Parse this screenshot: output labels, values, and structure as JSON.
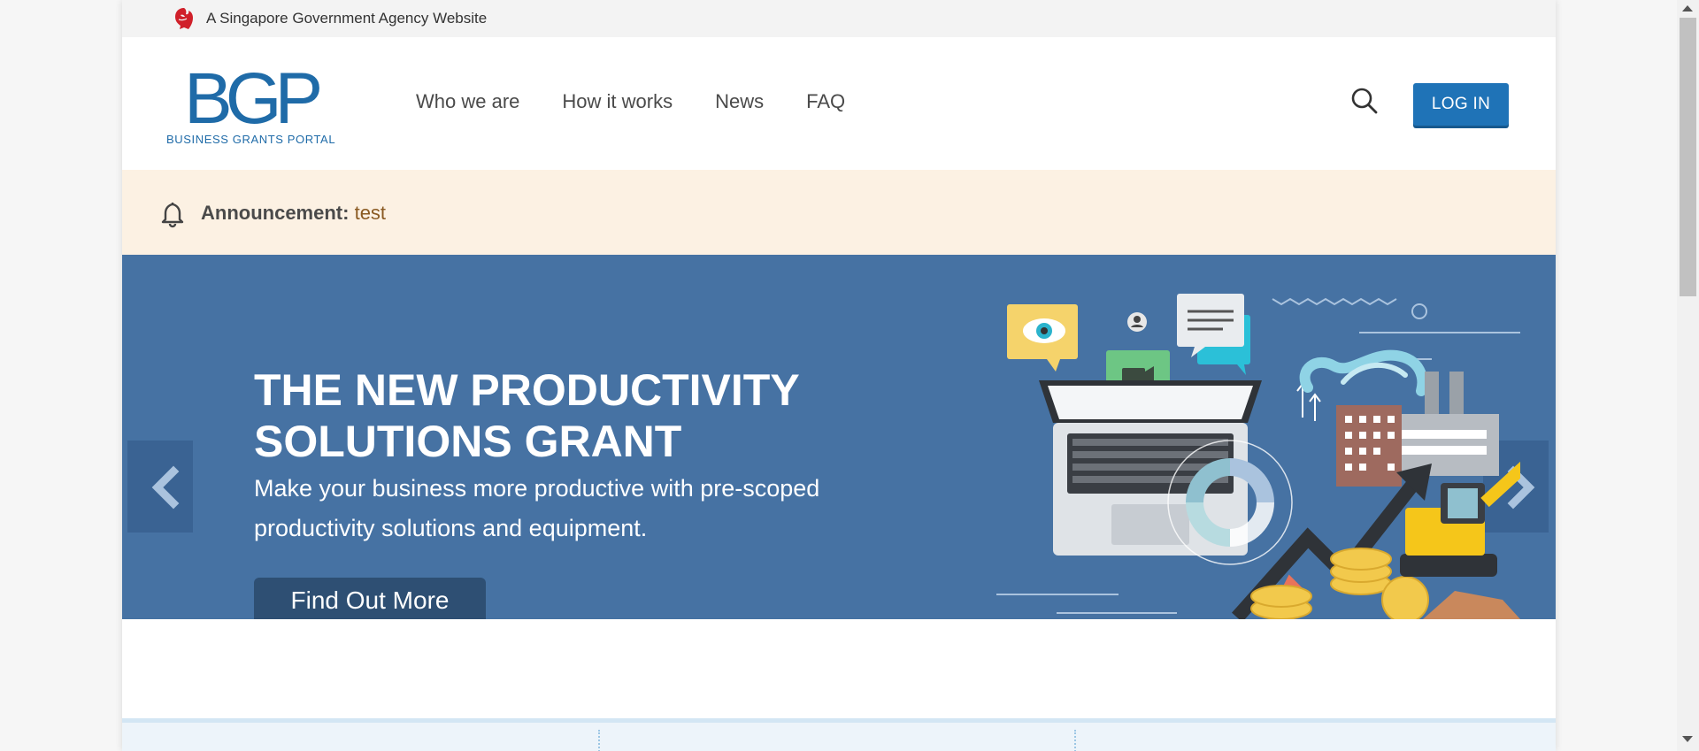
{
  "gov_strip": {
    "text": "A Singapore Government Agency Website",
    "icon": "lion-head-icon"
  },
  "header": {
    "logo_mark": "BGP",
    "logo_sub": "BUSINESS GRANTS PORTAL",
    "nav": [
      "Who we are",
      "How it works",
      "News",
      "FAQ"
    ],
    "search_icon": "search-icon",
    "login_label": "LOG IN"
  },
  "announcement": {
    "label": "Announcement:",
    "value": "test",
    "icon": "bell-icon"
  },
  "hero": {
    "title": "THE NEW PRODUCTIVITY SOLUTIONS GRANT",
    "description": "Make your business more productive with pre-scoped productivity solutions and equipment.",
    "cta_label": "Find Out More",
    "prev_icon": "chevron-left-icon",
    "next_icon": "chevron-right-icon"
  },
  "colors": {
    "brand_blue": "#1f6ba8",
    "login_blue": "#1f73b7",
    "hero_blue": "#4672a3",
    "announce_bg": "#fcf1e3",
    "cta_dark": "#2e4f73"
  }
}
